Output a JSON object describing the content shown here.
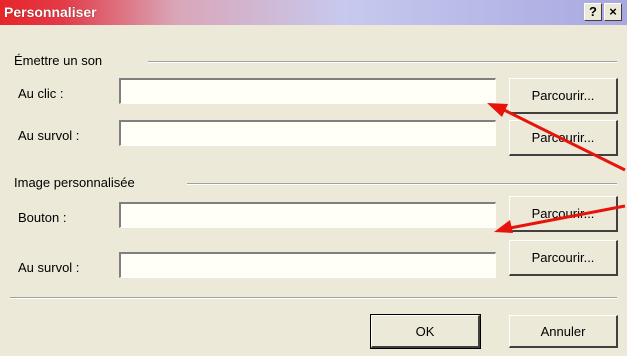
{
  "window": {
    "title": "Personnaliser",
    "help_button": "?",
    "close_button": "×"
  },
  "sound_group": {
    "label": "Émettre un son",
    "on_click": {
      "label": "Au clic :",
      "value": "",
      "browse_label": "Parcourir..."
    },
    "on_hover": {
      "label": "Au survol :",
      "value": "",
      "browse_label": "Parcourir..."
    }
  },
  "image_group": {
    "label": "Image personnalisée",
    "button": {
      "label": "Bouton :",
      "value": "",
      "browse_label": "Parcourir..."
    },
    "on_hover": {
      "label": "Au survol :",
      "value": "",
      "browse_label": "Parcourir..."
    }
  },
  "footer": {
    "ok_label": "OK",
    "cancel_label": "Annuler"
  },
  "annotations": {
    "arrow_color": "#e8140c"
  }
}
